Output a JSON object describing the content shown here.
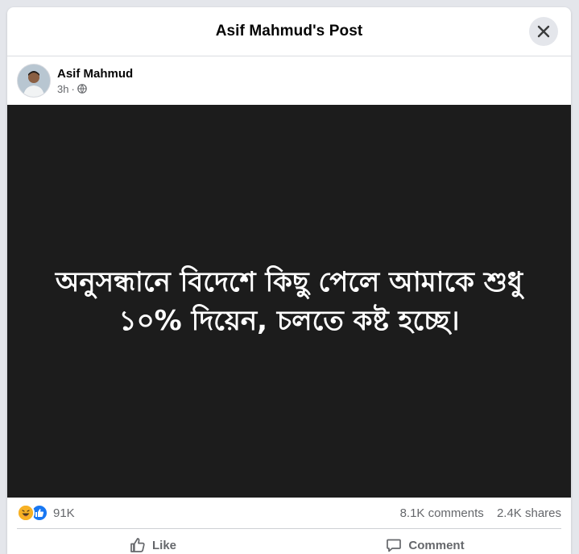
{
  "modal": {
    "title": "Asif Mahmud's Post"
  },
  "post": {
    "author": "Asif Mahmud",
    "time": "3h",
    "separator": "·",
    "privacy_icon": "globe-icon",
    "image_text_line1": "অনুসন্ধানে বিদেশে কিছু পেলে আমাকে শুধু",
    "image_text_line2": "১০% দিয়েন, চলতে কষ্ট হচ্ছে।"
  },
  "stats": {
    "reactions_count": "91K",
    "reaction_icons": [
      "haha-icon",
      "like-icon"
    ],
    "comments": "8.1K comments",
    "shares": "2.4K shares"
  },
  "actions": {
    "like_label": "Like",
    "comment_label": "Comment"
  },
  "colors": {
    "like_blue": "#1877f2",
    "haha_yellow": "#f7b125",
    "image_bg": "#1c1c1c",
    "secondary_text": "#65676b"
  }
}
